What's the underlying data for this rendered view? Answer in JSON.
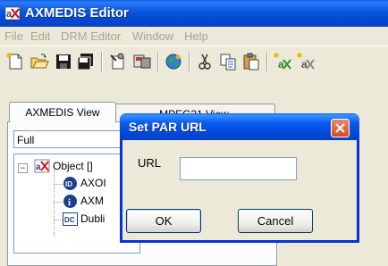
{
  "window": {
    "title": "AXMEDIS Editor"
  },
  "menu": [
    "File",
    "Edit",
    "DRM Editor",
    "Window",
    "Help"
  ],
  "toolbar": {
    "buttons": [
      "new-doc-icon",
      "open-folder-icon",
      "save-icon",
      "save-as-icon",
      "properties-icon",
      "publish-icon",
      "globe-icon",
      "cut-icon",
      "copy-icon",
      "paste-icon",
      "add-object-icon",
      "add-resource-icon"
    ]
  },
  "tabs": {
    "active": "AXMEDIS View",
    "inactive": "MPEG21 View"
  },
  "view_mode": "Full",
  "tree": {
    "root": "Object []",
    "children": [
      "AXOI",
      "AXM",
      "Dubli"
    ]
  },
  "dialog": {
    "title": "Set PAR URL",
    "url_label": "URL",
    "url_value": "",
    "ok_label": "OK",
    "cancel_label": "Cancel"
  }
}
